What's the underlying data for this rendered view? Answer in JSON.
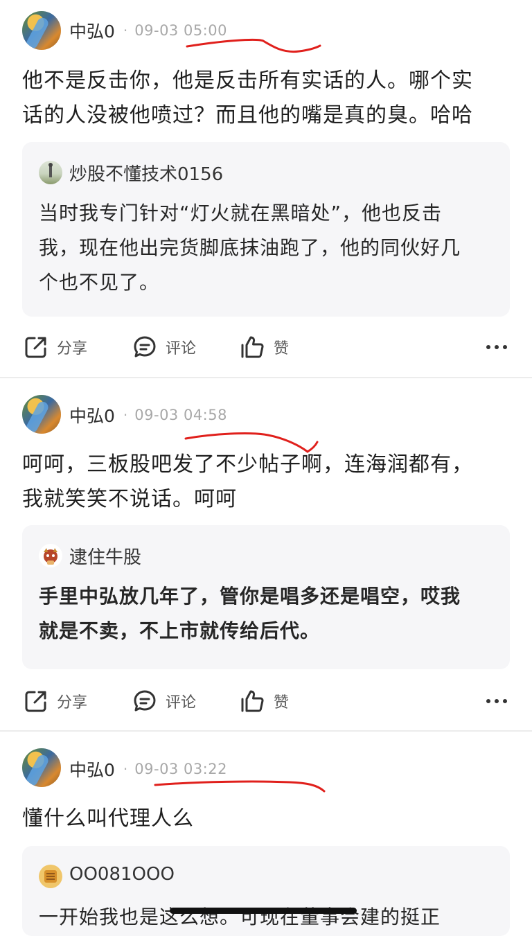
{
  "posts": [
    {
      "username": "中弘0",
      "separator": "·",
      "time": "09-03 05:00",
      "text_lines": [
        "他不是反击你，他是反击所有实话的人。哪个实",
        "话的人没被他喷过？而且他的嘴是真的臭。哈哈"
      ],
      "quote": {
        "username": "炒股不懂技术0156",
        "text_lines": [
          "当时我专门针对“灯火就在黑暗处”，他也反击",
          "我，现在他出完货脚底抹油跑了，他的同伙好几",
          "个也不见了。"
        ]
      },
      "actions": {
        "share": "分享",
        "comment": "评论",
        "like": "赞"
      }
    },
    {
      "username": "中弘0",
      "separator": "·",
      "time": "09-03 04:58",
      "text_lines": [
        "呵呵，三板股吧发了不少帖子啊，连海润都有，",
        "我就笑笑不说话。呵呵"
      ],
      "quote": {
        "username": "逮住牛股",
        "text_lines": [
          "手里中弘放几年了，管你是唱多还是唱空，哎我",
          "就是不卖，不上市就传给后代。"
        ]
      },
      "actions": {
        "share": "分享",
        "comment": "评论",
        "like": "赞"
      }
    },
    {
      "username": "中弘0",
      "separator": "·",
      "time": "09-03 03:22",
      "text_lines": [
        "懂什么叫代理人么"
      ],
      "quote": {
        "username": "OO081OOO",
        "text_lines": [
          "一开始我也是这么想。可现在董事会建的挺正"
        ]
      }
    }
  ],
  "colors": {
    "annotation_red": "#e0201c",
    "card_bg": "#f6f6f8"
  },
  "icons": [
    "share-icon",
    "comment-icon",
    "like-icon",
    "more-icon"
  ]
}
